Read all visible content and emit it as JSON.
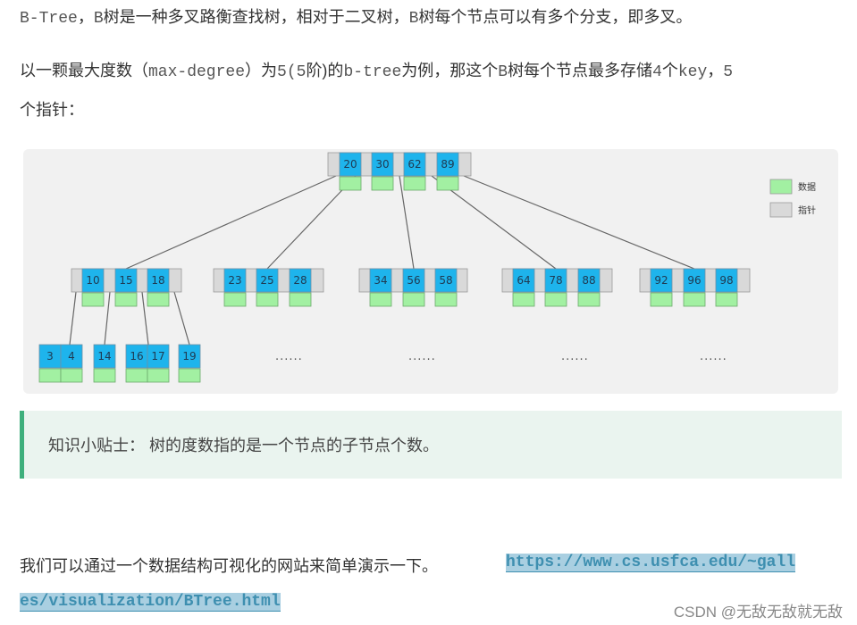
{
  "intro": {
    "p1_b_tree": "B-Tree",
    "p1_comma": "，",
    "p1_b": "B",
    "p1_text_a": "树是一种多叉路衡查找树，相对于二叉树，",
    "p1_b2": "B",
    "p1_text_b": "树每个节点可以有多个分支，即多叉。",
    "p2_text_a": "以一颗最大度数（",
    "p2_max_degree": "max-degree",
    "p2_text_b": "）为",
    "p2_num": "5(5",
    "p2_text_c": "阶)的",
    "p2_btree": "b-tree",
    "p2_text_d": "为例，那这个",
    "p2_b": "B",
    "p2_text_e": "树每个节点最多存储",
    "p2_4": "4",
    "p2_text_f": "个",
    "p2_key": "key",
    "p2_text_g": "，",
    "p2_5": "5",
    "p2b_text": "个指针："
  },
  "diagram": {
    "colors": {
      "key": "#1eb4ec",
      "pointer": "#d9d9d9",
      "data": "#a2f0a2",
      "edge": "#666666",
      "bg": "#f1f1f1"
    },
    "legend": [
      {
        "label": "数据",
        "type": "data"
      },
      {
        "label": "指针",
        "type": "pointer"
      }
    ],
    "nodes": [
      {
        "id": "root",
        "keys": [
          "20",
          "30",
          "62",
          "89"
        ]
      },
      {
        "id": "a",
        "keys": [
          "10",
          "15",
          "18"
        ]
      },
      {
        "id": "b",
        "keys": [
          "23",
          "25",
          "28"
        ]
      },
      {
        "id": "c",
        "keys": [
          "34",
          "56",
          "58"
        ]
      },
      {
        "id": "d",
        "keys": [
          "64",
          "78",
          "88"
        ]
      },
      {
        "id": "e",
        "keys": [
          "92",
          "96",
          "98"
        ]
      },
      {
        "id": "l1",
        "keys": [
          "3",
          "4"
        ]
      },
      {
        "id": "l2",
        "keys": [
          "14"
        ]
      },
      {
        "id": "l3",
        "keys": [
          "16",
          "17"
        ]
      },
      {
        "id": "l4",
        "keys": [
          "19"
        ]
      }
    ],
    "ellipses": [
      "......",
      "......",
      "......",
      "......"
    ]
  },
  "tip": {
    "text": "知识小贴士： 树的度数指的是一个节点的子节点个数。"
  },
  "outro": {
    "p3_text": "我们可以通过一个数据结构可视化的网站来简单演示一下。",
    "link_line1": "https://www.cs.usfca.edu/~gall",
    "link_line2": "es/visualization/BTree.html"
  },
  "watermark": "CSDN @无敌无敌就无敌"
}
